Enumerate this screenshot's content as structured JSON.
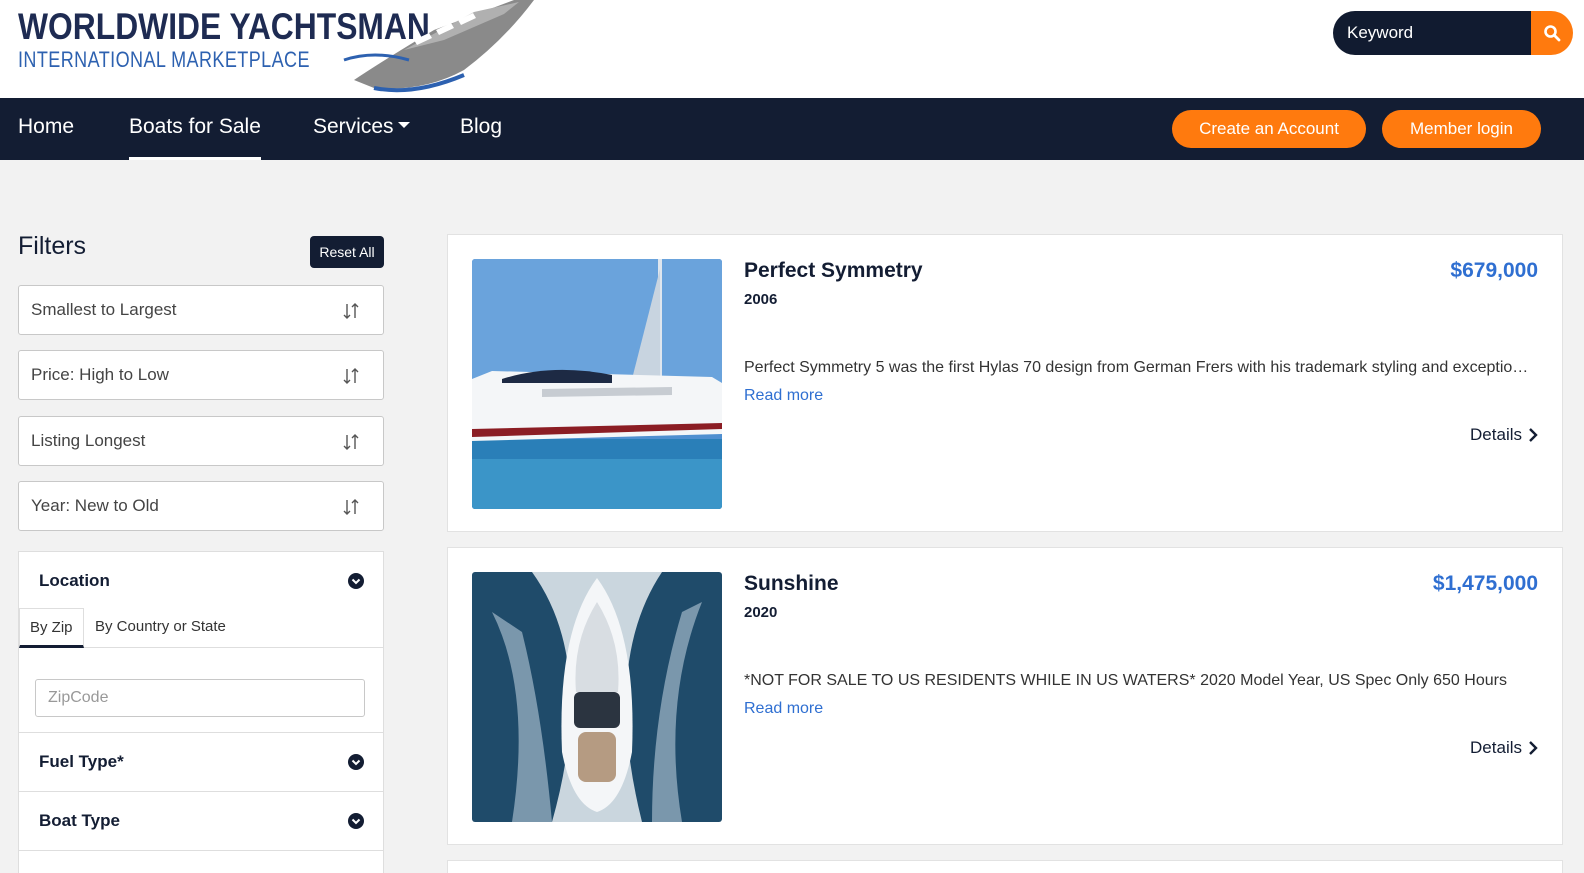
{
  "brand": {
    "line1": "WORLDWIDE YACHTSMAN",
    "line2": "INTERNATIONAL MARKETPLACE"
  },
  "search": {
    "placeholder": "Keyword",
    "icon": "search-icon"
  },
  "nav": {
    "items": [
      {
        "label": "Home"
      },
      {
        "label": "Boats for Sale",
        "active": true
      },
      {
        "label": "Services",
        "dropdown": true
      },
      {
        "label": "Blog"
      }
    ],
    "create_account": "Create an Account",
    "member_login": "Member login"
  },
  "sidebar": {
    "title": "Filters",
    "reset_label": "Reset All",
    "sorts": [
      {
        "label": "Smallest to Largest"
      },
      {
        "label": "Price: High to Low"
      },
      {
        "label": "Listing Longest"
      },
      {
        "label": "Year: New to Old"
      }
    ],
    "location": {
      "title": "Location",
      "tabs": [
        {
          "label": "By Zip",
          "active": true
        },
        {
          "label": "By Country or State"
        }
      ],
      "zip_placeholder": "ZipCode"
    },
    "fuel_type": {
      "title": "Fuel Type*"
    },
    "boat_type": {
      "title": "Boat Type"
    }
  },
  "listings": [
    {
      "name": "Perfect Symmetry",
      "year": "2006",
      "price": "$679,000",
      "description": "Perfect Symmetry 5 was the first Hylas 70 design from German Frers with his trademark styling and exceptional performance",
      "read_more": "Read more",
      "details": "Details"
    },
    {
      "name": "Sunshine",
      "year": "2020",
      "price": "$1,475,000",
      "description": "*NOT FOR SALE TO US RESIDENTS WHILE IN US WATERS*   2020 Model Year, US Spec Only 650 Hours",
      "read_more": "Read more",
      "details": "Details"
    }
  ],
  "colors": {
    "navy": "#131d33",
    "orange": "#ff7a0e",
    "link_blue": "#2f6fd1",
    "background": "#f2f2f2"
  }
}
